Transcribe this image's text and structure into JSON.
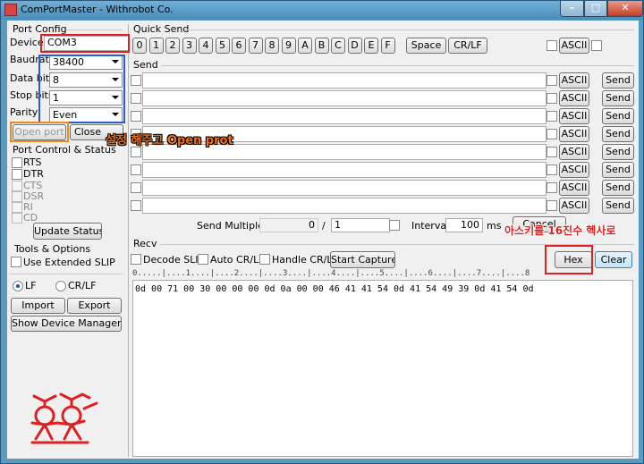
{
  "window": {
    "title": "ComPortMaster - Withrobot Co."
  },
  "port_config": {
    "section": "Port Config",
    "device_label": "Device",
    "device_value": "COM3",
    "baudrate_label": "Baudrate",
    "baudrate_value": "38400",
    "databits_label": "Data bits",
    "databits_value": "8",
    "stopbits_label": "Stop bits",
    "stopbits_value": "1",
    "parity_label": "Parity",
    "parity_value": "Even",
    "open_label": "Open port",
    "close_label": "Close"
  },
  "port_control": {
    "section": "Port Control & Status",
    "rts": "RTS",
    "dtr": "DTR",
    "cts": "CTS",
    "dsr": "DSR",
    "ri": "RI",
    "cd": "CD",
    "update_label": "Update Status"
  },
  "tools": {
    "section": "Tools & Options",
    "extended_slip": "Use Extended SLIP",
    "lf": "LF",
    "crlf": "CR/LF",
    "import_label": "Import",
    "export_label": "Export",
    "device_manager_label": "Show Device Manager"
  },
  "quick_send": {
    "section": "Quick Send",
    "keys": [
      "0",
      "1",
      "2",
      "3",
      "4",
      "5",
      "6",
      "7",
      "8",
      "9",
      "A",
      "B",
      "C",
      "D",
      "E",
      "F"
    ],
    "space_label": "Space",
    "crlf_label": "CR/LF",
    "ascii_label": "ASCII"
  },
  "send": {
    "section": "Send",
    "ascii_label": "ASCII",
    "send_label": "Send",
    "multiple_label": "Send Multiple :",
    "multiple_count": "0",
    "multiple_separator": "/",
    "multiple_total": "1",
    "interval_label": "Interval",
    "interval_value": "100",
    "interval_unit": "ms",
    "cancel_label": "Cancel"
  },
  "recv": {
    "section": "Recv",
    "decode_slip": "Decode SLIP",
    "auto_crlf": "Auto CR/LF",
    "handle_crlf": "Handle CR/LF",
    "start_capture_label": "Start Capture",
    "hex_label": "Hex",
    "clear_label": "Clear",
    "ruler": "0.....|....1....|....2....|....3....|....4....|....5....|....6....|....7....|....8",
    "data": "0d 00 71 00 30 00 00 00 0d 0a 00 00 46 41 41 54 0d 41 54 49 39 0d 41 54 0d"
  },
  "annotations": {
    "open_note": "설정 해주고 Open prot",
    "hex_note": "아스키를 16진수 헥사로"
  },
  "colors": {
    "annotation_red": "#e02020",
    "annotation_blue": "#2a5bd6",
    "annotation_orange": "#f08a20",
    "logo_red": "#e02020"
  }
}
